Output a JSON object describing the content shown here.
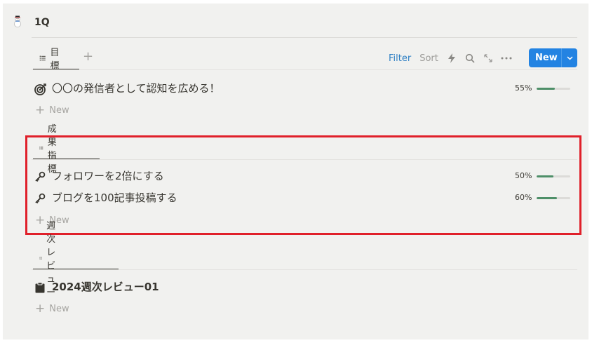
{
  "page": {
    "title": "1Q",
    "icon": "snowman-icon"
  },
  "toolbar": {
    "filter_label": "Filter",
    "sort_label": "Sort",
    "new_label": "New",
    "icons": [
      "lightning-icon",
      "search-icon",
      "expand-icon",
      "more-icon",
      "chevron-down-icon"
    ]
  },
  "sections": [
    {
      "tab": "目標",
      "items": [
        {
          "title": "〇〇の発信者として認知を広める！",
          "icon": "target-icon",
          "percent_label": "55%",
          "progress": 0.55
        }
      ],
      "new_label": "New"
    },
    {
      "tab": "成果指標",
      "items": [
        {
          "title": "フォロワーを2倍にする",
          "icon": "key-icon",
          "percent_label": "50%",
          "progress": 0.5
        },
        {
          "title": "ブログを100記事投稿する",
          "icon": "key-icon",
          "percent_label": "60%",
          "progress": 0.6
        }
      ],
      "new_label": "New"
    },
    {
      "tab": "週次レビュー",
      "items": [
        {
          "title": "2024週次レビュー01",
          "icon": "clipboard-icon"
        }
      ],
      "new_label": "New"
    }
  ],
  "colors": {
    "accent": "#2383e2",
    "progress": "#4e8f68",
    "highlight": "#e0202a",
    "filter": "#2f80c4"
  }
}
